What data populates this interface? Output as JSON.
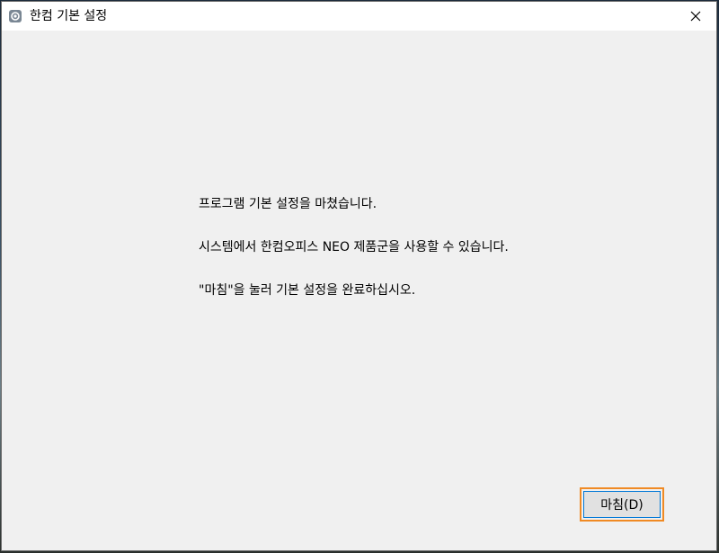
{
  "window": {
    "title": "한컴 기본 설정",
    "icon": "hancom-gear-icon",
    "close_icon": "close-icon"
  },
  "content": {
    "messages": [
      "프로그램 기본 설정을 마쳤습니다.",
      "시스템에서 한컴오피스 NEO 제품군을 사용할 수 있습니다.",
      "\"마침\"을 눌러 기본 설정을 완료하십시오."
    ]
  },
  "buttons": {
    "finish_label": "마침(D)"
  },
  "colors": {
    "focus_outline": "#f08a24",
    "button_border": "#0078d7",
    "dialog_bg": "#f0f0f0"
  }
}
